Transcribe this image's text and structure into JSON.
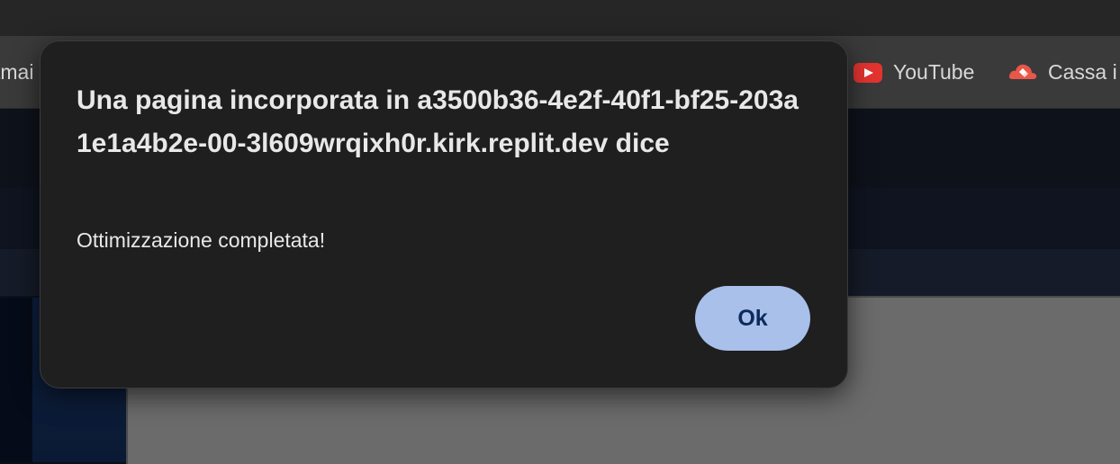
{
  "bookmarks": {
    "left_partial": "tmai",
    "items": [
      {
        "label": "YouTube",
        "icon": "youtube-icon"
      },
      {
        "label": "Cassa i",
        "icon": "cassa-icon"
      }
    ]
  },
  "dialog": {
    "title": "Una pagina incorporata in a3500b36-4e2f-40f1-bf25-203a1e1a4b2e-00-3l609wrqixh0r.kirk.replit.dev dice",
    "message": "Ottimizzazione completata!",
    "ok_label": "Ok"
  },
  "colors": {
    "dialog_bg": "#1f1f1f",
    "ok_bg": "#a8c0ea",
    "ok_text": "#0c2a5c",
    "youtube_red": "#e3342f",
    "cassa_red": "#e8574a"
  }
}
